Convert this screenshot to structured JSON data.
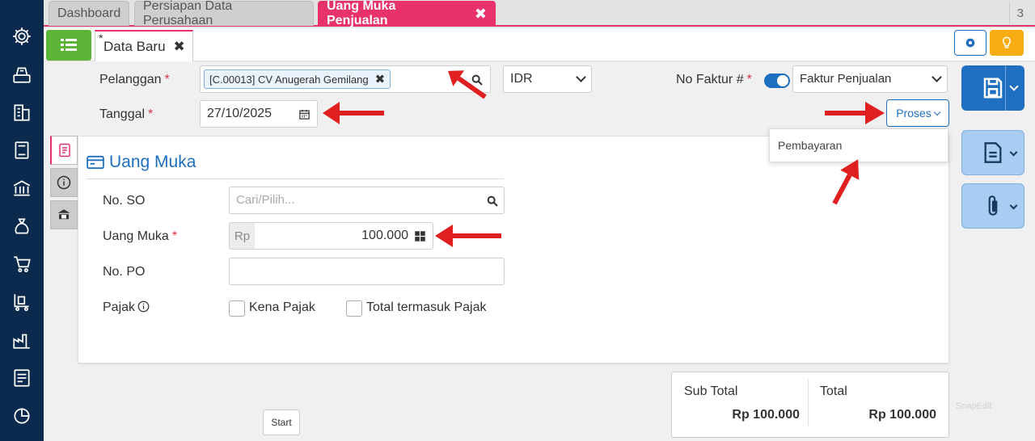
{
  "tabs": [
    {
      "label": "Dashboard"
    },
    {
      "label": "Persiapan Data Perusahaan"
    },
    {
      "label": "Uang Muka Penjualan",
      "close": "✖"
    }
  ],
  "tab_count": "3",
  "doc_tab": {
    "star": "*",
    "label": "Data Baru",
    "close": "✖"
  },
  "form": {
    "pelanggan_label": "Pelanggan",
    "pelanggan_value": "[C.00013] CV Anugerah Gemilang",
    "chip_close": "✖",
    "currency": "IDR",
    "tanggal_label": "Tanggal",
    "tanggal_value": "27/10/2025",
    "no_faktur_label": "No Faktur #",
    "faktur_type": "Faktur Penjualan",
    "proses_label": "Proses",
    "required_mark": "*"
  },
  "menu": {
    "item": "Pembayaran"
  },
  "panel": {
    "title": "Uang Muka",
    "no_so_label": "No. SO",
    "no_so_placeholder": "Cari/Pilih...",
    "uang_muka_label": "Uang Muka",
    "currency_prefix": "Rp",
    "uang_muka_value": "100.000",
    "no_po_label": "No. PO",
    "pajak_label": "Pajak",
    "kena_pajak_label": "Kena Pajak",
    "total_termasuk_label": "Total termasuk Pajak"
  },
  "totals": {
    "sub_total_label": "Sub Total",
    "sub_total_value": "Rp 100.000",
    "total_label": "Total",
    "total_value": "Rp 100.000"
  },
  "start_label": "Start",
  "watermark": "SnapEdit",
  "colors": {
    "accent": "#e8326b",
    "primary": "#1f6fc1",
    "sidebar": "#0b2a4d",
    "green": "#5db538",
    "orange": "#f7ac12",
    "arrow": "#e02020"
  }
}
